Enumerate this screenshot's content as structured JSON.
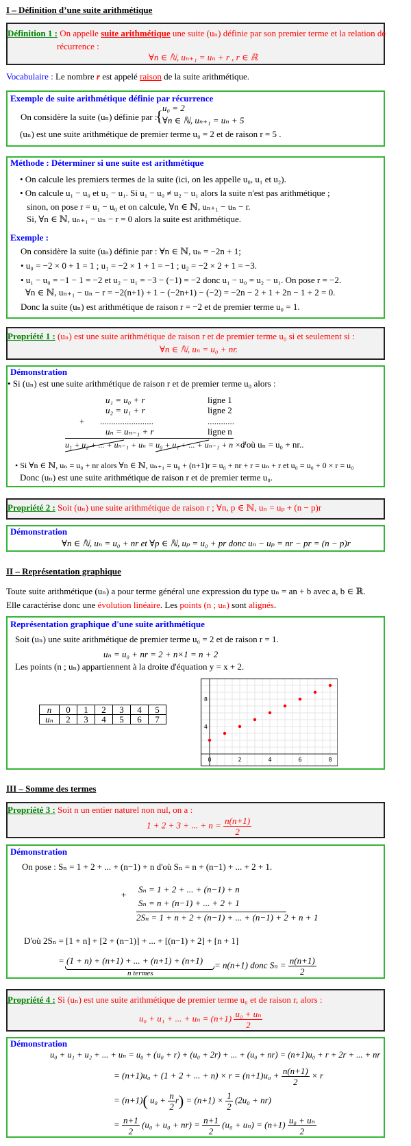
{
  "s1": {
    "title": "I – Définition d’une suite arithmétique"
  },
  "def1": {
    "label": "Définition 1 :",
    "t1": "On appelle",
    "t2": "suite arithmétique",
    "t3": "une suite (uₙ) définie par son premier terme et la relation de",
    "t4": "récurrence :",
    "formula": "∀n ∈ ℕ, uₙ₊₁ = uₙ + r ,  r ∈ ℝ"
  },
  "vocab": {
    "label": "Vocabulaire :",
    "t1": "Le nombre",
    "r": "r",
    "t2": "est appelé",
    "raison": "raison",
    "t3": "de la suite arithmétique."
  },
  "ex1": {
    "head": "Exemple de suite arithmétique définie par récurrence",
    "t1": "On considère la suite (uₙ) définie par :",
    "sys1": "u₀ = 2",
    "sys2": "∀n ∈ ℕ, uₙ₊₁ = uₙ + 5",
    "t2": "(uₙ) est une suite arithmétique de premier terme  u₀ = 2  et de raison  r = 5 ."
  },
  "meth": {
    "head": "Méthode : Déterminer si une suite est arithmétique",
    "l1": "• On calcule les premiers termes de la suite (ici, on les appelle  u₀, u₁  et u₂).",
    "l2": "• On calcule  u₁ − u₀  et u₂ − u₁.  Si  u₁ − u₀ ≠ u₂ − u₁  alors la suite n'est pas arithmétique ;",
    "l3": "sinon, on pose  r = u₁ − u₀  et on calcule, ∀n ∈ ℕ, uₙ₊₁ − uₙ − r.",
    "l4": "Si, ∀n ∈ ℕ, uₙ₊₁ − uₙ − r = 0  alors la suite est arithmétique.",
    "exhead": "Exemple :",
    "e1": "On considère la suite (uₙ) définie par : ∀n ∈ ℕ, uₙ = −2n + 1;",
    "e2": "•  u₀ = −2 × 0 + 1 = 1 ; u₁ = −2 × 1 + 1 = −1 ; u₂ = −2 × 2 + 1 = −3.",
    "e3": "•  u₁ − u₀ = −1 − 1 = −2 et u₂ − u₁ = −3 − (−1) = −2  donc u₁ − u₀ = u₂ − u₁.  On pose  r = −2.",
    "e4": "∀n ∈ ℕ, uₙ₊₁ − uₙ − r = −2(n+1) + 1 − (−2n+1) − (−2) = −2n − 2 + 1 + 2n − 1 + 2 = 0.",
    "e5": "Donc la suite (uₙ)  est arithmétique de raison  r = −2  et de premier terme  u₀ = 1."
  },
  "prop1": {
    "label": "Propriété 1 :",
    "t1": "(uₙ)  est une suite arithmétique de raison r et de premier terme  u₀  si et seulement si :",
    "formula": "∀n ∈ ℕ, uₙ = u₀ + nr."
  },
  "demo1": {
    "head": "Démonstration",
    "l1": "• Si  (uₙ)  est une suite arithmétique de raison r et de premier terme  u₀  alors :",
    "rows": [
      {
        "eq": "u₁ = u₀ + r",
        "tag": "ligne 1"
      },
      {
        "eq": "u₂ = u₁ + r",
        "tag": "ligne 2"
      },
      {
        "eq": "........................",
        "tag": "............"
      },
      {
        "eq": "uₙ = uₙ₋₁ + r",
        "tag": "ligne n"
      }
    ],
    "plus": "+",
    "sum": "u₁ + u₂ + ... + uₙ₋₁ + uₙ = u₀ + u₁ + ... + uₙ₋₁ + n × r",
    "concl": "d'où   uₙ = u₀ + nr..",
    "l2": "• Si  ∀n ∈ ℕ,  uₙ = u₀ + nr  alors  ∀n ∈ ℕ,  uₙ₊₁ = u₀ + (n+1)r = u₀ + nr + r = uₙ + r   et   u₀ = u₀ + 0 × r = u₀",
    "l3": "Donc  (uₙ)  est une suite arithmétique de raison r et de premier terme  u₀."
  },
  "prop2": {
    "label": "Propriété 2 :",
    "t1": "Soit (uₙ)  une suite arithmétique de raison r ;  ∀n, p ∈ ℕ, uₙ = uₚ + (n − p)r"
  },
  "demo2": {
    "head": "Démonstration",
    "formula": "∀n ∈ ℕ, uₙ = u₀ + nr   et  ∀p ∈ ℕ, uₚ = u₀ + pr   donc  uₙ − uₚ = nr − pr = (n − p)r"
  },
  "s2": {
    "title": "II – Représentation graphique",
    "l1": "Toute suite arithmétique (uₙ) a pour terme général une expression du type  uₙ = an + b avec a, b ∈ ℝ.",
    "l2a": "Elle caractérise donc une",
    "l2b": "évolution linéaire",
    "l2c": ". Les",
    "l2d": "points (n ; uₙ)",
    "l2e": "sont",
    "l2f": "alignés",
    "l2g": "."
  },
  "repr": {
    "head": "Représentation graphique d'une suite arithmétique",
    "l1": "Soit  (uₙ)  une suite arithmétique de premier terme  u₀ = 2  et de raison  r = 1.",
    "l2": "uₙ = u₀ + nr = 2 + n×1 = n + 2",
    "l3": "Les points  (n ; uₙ)  appartiennent à la droite d'équation  y = x + 2.",
    "table": {
      "row1_label": "n",
      "row1": [
        "0",
        "1",
        "2",
        "3",
        "4",
        "5"
      ],
      "row2_label": "uₙ",
      "row2": [
        "2",
        "3",
        "4",
        "5",
        "6",
        "7"
      ]
    }
  },
  "chart_data": {
    "type": "scatter",
    "x": [
      0,
      1,
      2,
      3,
      4,
      5,
      6,
      7,
      8
    ],
    "y": [
      2,
      3,
      4,
      5,
      6,
      7,
      8,
      9,
      10
    ],
    "xlim": [
      0,
      8.4
    ],
    "ylim": [
      0,
      10.5
    ],
    "xticks": [
      "0",
      "2",
      "4",
      "6",
      "8"
    ],
    "yticks": [
      "4",
      "8"
    ],
    "grid": true,
    "point_color": "#ff0000"
  },
  "s3": {
    "title": "III – Somme des termes"
  },
  "prop3": {
    "label": "Propriété 3 :",
    "t1": "Soit n un entier naturel non nul, on a :",
    "lhs": "1 + 2 + 3 + ... + n =",
    "num": "n(n+1)",
    "den": "2"
  },
  "demo3": {
    "head": "Démonstration",
    "l1": "On pose :  Sₙ = 1 + 2 + ... + (n−1) + n   d'où  Sₙ = n + (n−1) + ... + 2 + 1.",
    "plus": "+",
    "r1": "Sₙ = 1 + 2 + ... + (n−1) + n",
    "r2": "Sₙ = n + (n−1) + ... + 2 + 1",
    "r3": "2Sₙ = 1 + n + 2 + (n−1) + ... + (n−1) + 2 + n + 1",
    "l2": "D'où  2Sₙ = [1 + n] + [2 + (n−1)] + ... + [(n−1) + 2] + [n + 1]",
    "l3a": "= (1 + n) +     (n+1)     + ... +     (n+1)     + (n+1)",
    "l3b": "= n(n+1)  donc  Sₙ =",
    "num": "n(n+1)",
    "den": "2",
    "brace": "n termes"
  },
  "prop4": {
    "label": "Propriété 4 :",
    "t1": "Si  (uₙ)  est une suite arithmétique de premier terme  u₀  et de raison  r,  alors :",
    "lhs": "u₀ + u₁ + ... + uₙ = (n+1)",
    "num": "u₀ + uₙ",
    "den": "2"
  },
  "demo4": {
    "head": "Démonstration",
    "e1": "u₀ + u₁ + u₂ + ... + uₙ = u₀ + (u₀ + r) + (u₀ + 2r) + ... + (u₀ + nr) = (n+1)u₀ + r + 2r + ... + nr",
    "e2a": "= (n+1)u₀ + (1 + 2 + ... + n) × r = (n+1)u₀ +",
    "e2num": "n(n+1)",
    "e2den": "2",
    "e2b": "× r",
    "e3a": "= (n+1)",
    "e3b": "u₀ +",
    "e3num": "n",
    "e3den": "2",
    "e3c": "r",
    "e3d": "= (n+1) ×",
    "e3num2": "1",
    "e3den2": "2",
    "e3e": "(2u₀ + nr)",
    "e4a": "=",
    "e4num1": "n+1",
    "e4den1": "2",
    "e4b": "(u₀ + u₀ + nr) =",
    "e4num2": "n+1",
    "e4den2": "2",
    "e4c": "(u₀ + uₙ) = (n+1)",
    "e4num3": "u₀ + uₙ",
    "e4den3": "2"
  }
}
